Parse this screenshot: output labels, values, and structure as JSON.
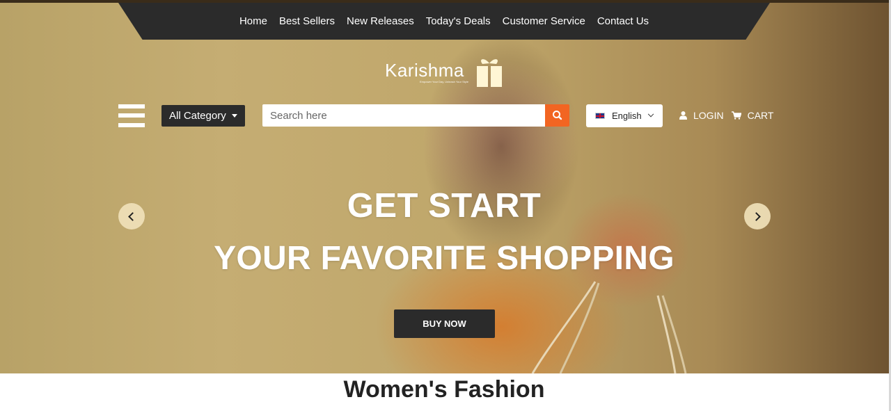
{
  "nav": {
    "items": [
      "Home",
      "Best Sellers",
      "New Releases",
      "Today's Deals",
      "Customer Service",
      "Contact Us"
    ]
  },
  "logo": {
    "name": "Karishma",
    "tagline": "Empower Your Day, Unleash Your Style"
  },
  "toolbar": {
    "category_label": "All Category",
    "search_placeholder": "Search here",
    "language": "English",
    "login_label": "LOGIN",
    "cart_label": "CART"
  },
  "hero": {
    "title_line1": "GET START",
    "title_line2": "YOUR FAVORITE SHOPPING",
    "cta_label": "BUY NOW"
  },
  "section": {
    "title": "Women's Fashion"
  },
  "colors": {
    "dark": "#2b2b2b",
    "accent": "#f26522",
    "hero_tone": "#c5ad73"
  },
  "icons": [
    "menu-icon",
    "caret-down-icon",
    "search-icon",
    "flag-uk-icon",
    "chevron-down-icon",
    "user-icon",
    "cart-icon",
    "gift-icon",
    "chevron-left-icon",
    "chevron-right-icon"
  ]
}
